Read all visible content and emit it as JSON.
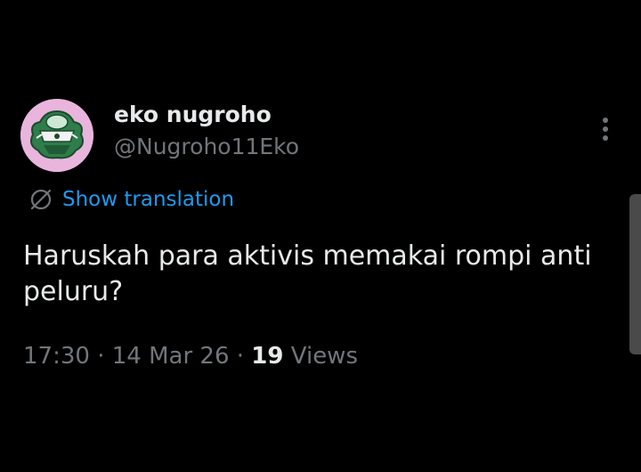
{
  "user": {
    "display_name": "eko nugroho",
    "handle": "@Nugroho11Eko"
  },
  "translate": {
    "label": "Show translation",
    "icon": "globe-translate-icon"
  },
  "tweet": {
    "text": "Haruskah para aktivis memakai rompi anti peluru?"
  },
  "meta": {
    "time": "17:30",
    "separator": "·",
    "date": "14 Mar 26",
    "views_count": "19",
    "views_label": "Views"
  },
  "colors": {
    "background": "#000000",
    "primary_text": "#e7e9ea",
    "secondary_text": "#71767b",
    "accent": "#1d9bf0",
    "avatar_bg": "#e9b5dd"
  }
}
